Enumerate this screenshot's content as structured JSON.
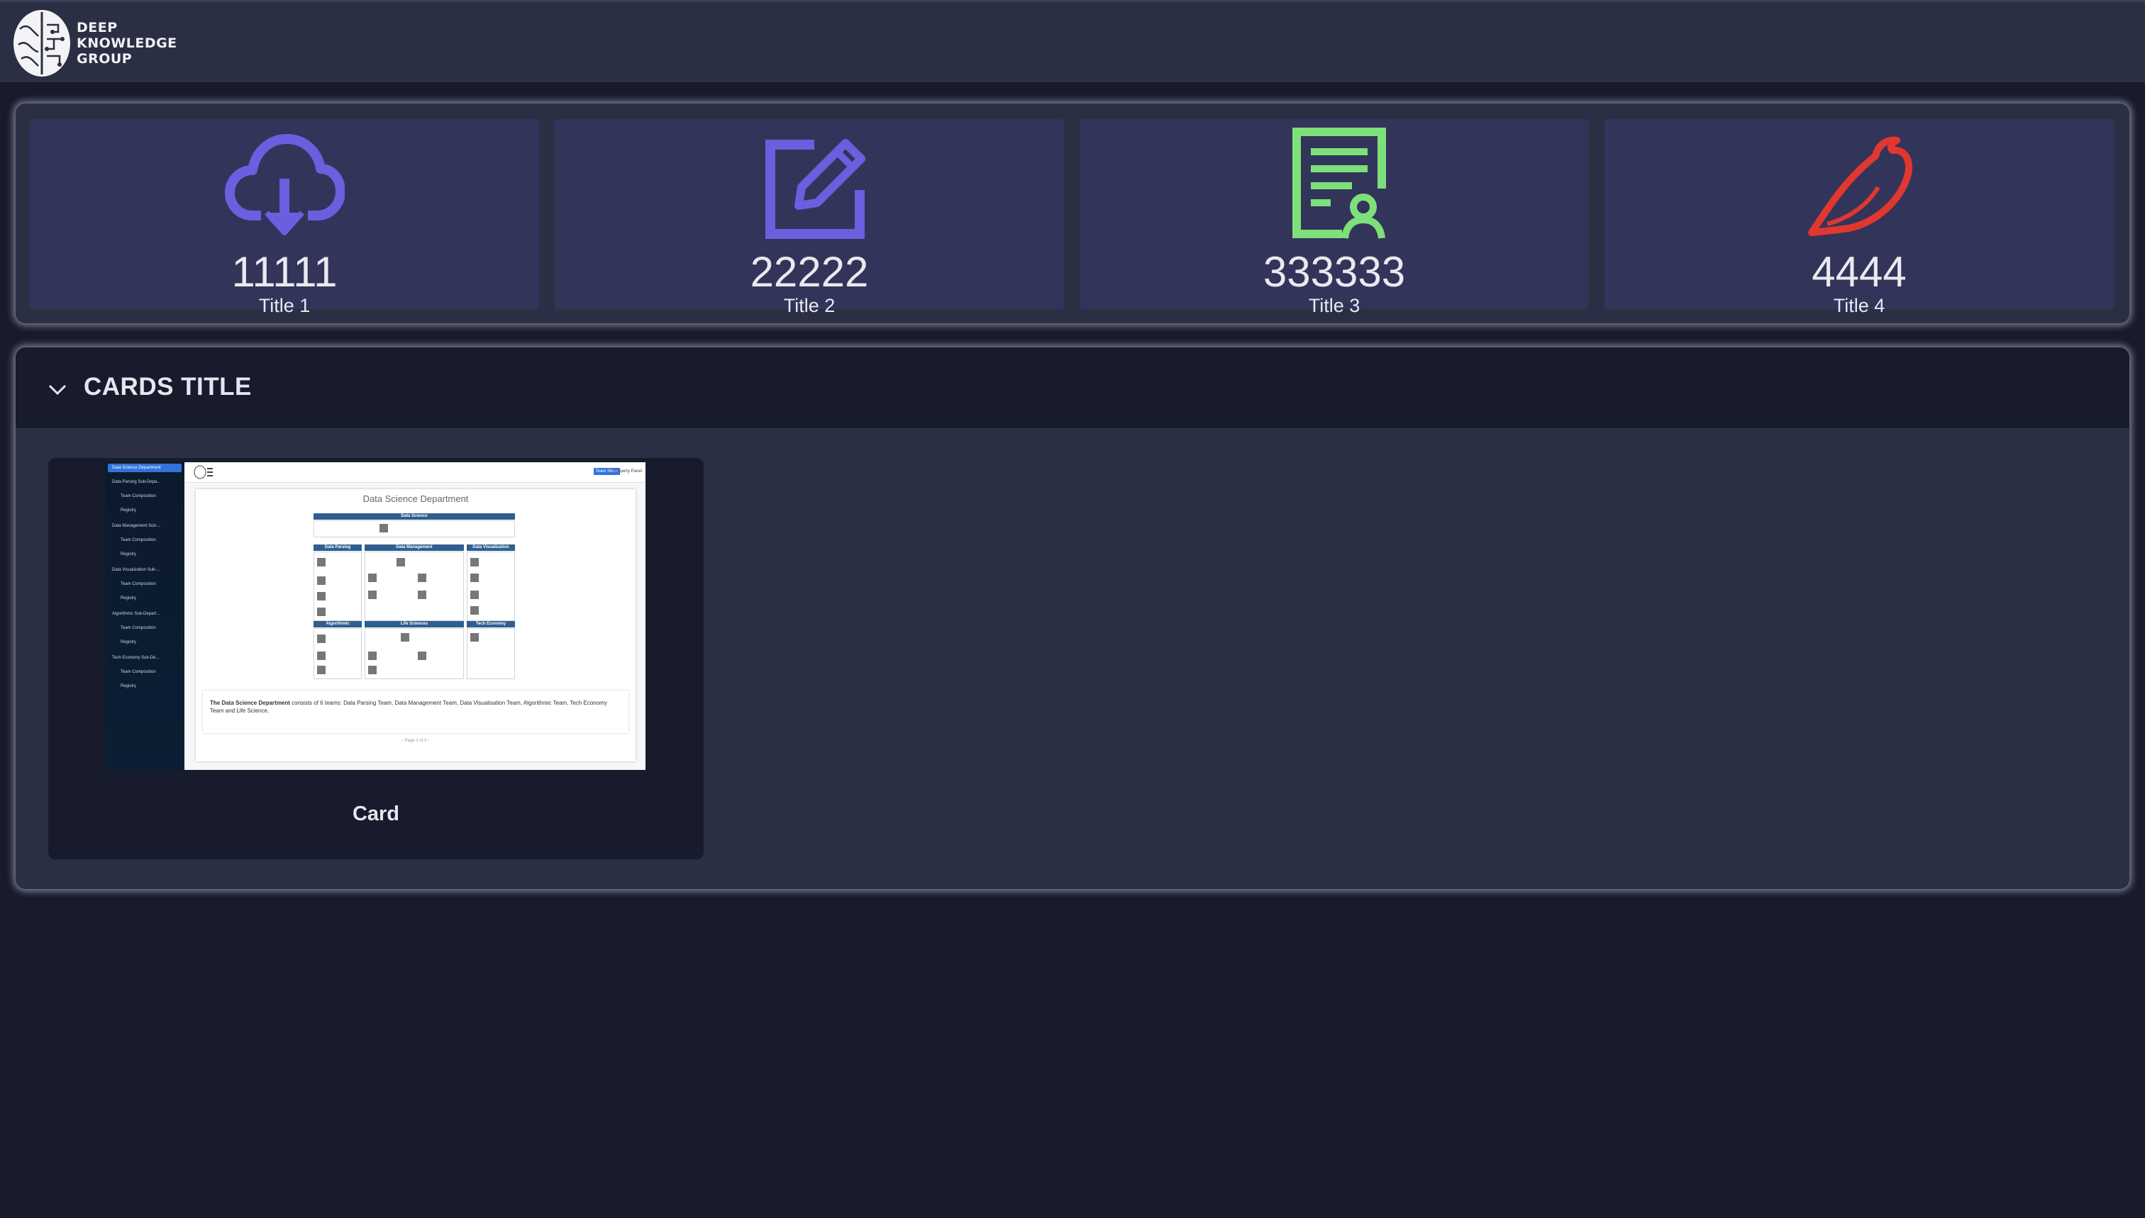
{
  "brand": {
    "name_lines": [
      "DEEP",
      "KNOWLEDGE",
      "GROUP"
    ],
    "logo_icon": "brain-circuit-icon"
  },
  "stats": [
    {
      "value": "11111",
      "title": "Title 1",
      "icon": "cloud-download-icon",
      "color": "#6a5fdf"
    },
    {
      "value": "22222",
      "title": "Title 2",
      "icon": "edit-square-icon",
      "color": "#6a5fdf"
    },
    {
      "value": "333333",
      "title": "Title 3",
      "icon": "document-user-icon",
      "color": "#7de07a"
    },
    {
      "value": "4444",
      "title": "Title 4",
      "icon": "bird-icon",
      "color": "#e0372f"
    }
  ],
  "cards_section": {
    "title": "CARDS TITLE",
    "toggle_icon": "chevron-down-icon",
    "cards": [
      {
        "label": "Card",
        "thumbnail": {
          "sidebar_items": [
            "Data Science Department",
            "Data Parsing Sub-Depa...",
            "Team Composition",
            "Registry",
            "Data Management Sub-...",
            "Team Composition",
            "Registry",
            "Data Visualization Sub-...",
            "Team Composition",
            "Registry",
            "Algorithmic Sub-Depart...",
            "Team Composition",
            "Registry",
            "Tech Economy Sub-De...",
            "Team Composition",
            "Registry"
          ],
          "top_buttons": [
            "Team Show",
            "Property Panel"
          ],
          "doc_title": "Data Science Department",
          "org_units": [
            "Data Science",
            "Data Parsing",
            "Data Management",
            "Data Visualization",
            "Algorithmic",
            "Life Sciences",
            "Tech Economy"
          ],
          "description_bold": "The Data Science Department",
          "description_rest": " consists of 6 teams: Data Parsing Team, Data Management Team, Data Visualisation Team, Algorithmic Team, Tech Economy Team and Life Science.",
          "pager": "‹  Page 1 of 3  ›"
        }
      }
    ]
  },
  "colors": {
    "page_bg": "#181b2c",
    "panel_bg": "#2b2f44",
    "stat_card_bg": "#33345a",
    "accent_purple": "#6a5fdf",
    "accent_green": "#7de07a",
    "accent_red": "#e0372f"
  }
}
